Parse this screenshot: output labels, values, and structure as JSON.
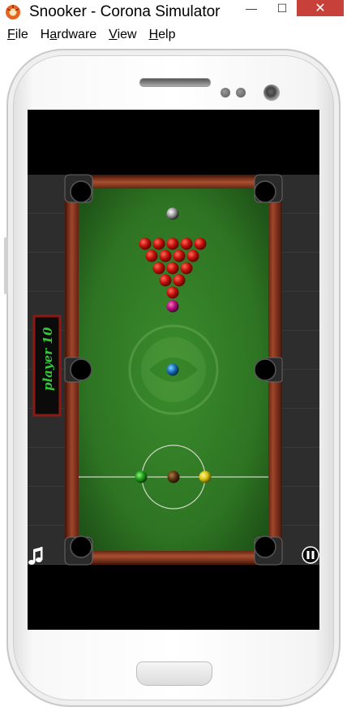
{
  "window": {
    "title": "Snooker - Corona Simulator",
    "minimize_label": "—",
    "maximize_label": "☐",
    "close_label": "✕"
  },
  "menu": {
    "file": {
      "accel": "F",
      "rest": "ile"
    },
    "hardware": {
      "pre": "H",
      "accel": "a",
      "rest": "rdware"
    },
    "view": {
      "accel": "V",
      "rest": "iew"
    },
    "help": {
      "accel": "H",
      "rest": "elp"
    }
  },
  "game": {
    "score_label": "player 1",
    "score_value": "0",
    "music_icon": "music-note-icon",
    "pause_icon": "pause-icon"
  },
  "colors": {
    "felt": "#2f7a26",
    "cushion": "#8b3a22",
    "scoreboard_text": "#35c63a",
    "close_button": "#c7403a"
  }
}
